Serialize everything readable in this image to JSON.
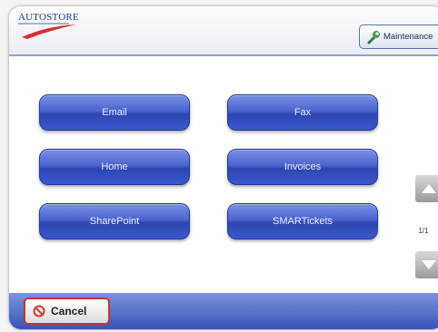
{
  "header": {
    "logo_text": "AUTOSTORE",
    "maintenance_label": "Maintenance"
  },
  "main": {
    "buttons": [
      {
        "label": "Email"
      },
      {
        "label": "Fax"
      },
      {
        "label": "Home"
      },
      {
        "label": "Invoices"
      },
      {
        "label": "SharePoint"
      },
      {
        "label": "SMARTickets"
      }
    ],
    "page_indicator": "1/1"
  },
  "footer": {
    "cancel_label": "Cancel"
  },
  "colors": {
    "button_blue": "#3a57cf",
    "footer_blue": "#3553b9",
    "cancel_red": "#c8342c"
  },
  "icons": [
    "autostore-logo",
    "wrench-icon",
    "scroll-up-icon",
    "scroll-down-icon",
    "cancel-icon"
  ]
}
